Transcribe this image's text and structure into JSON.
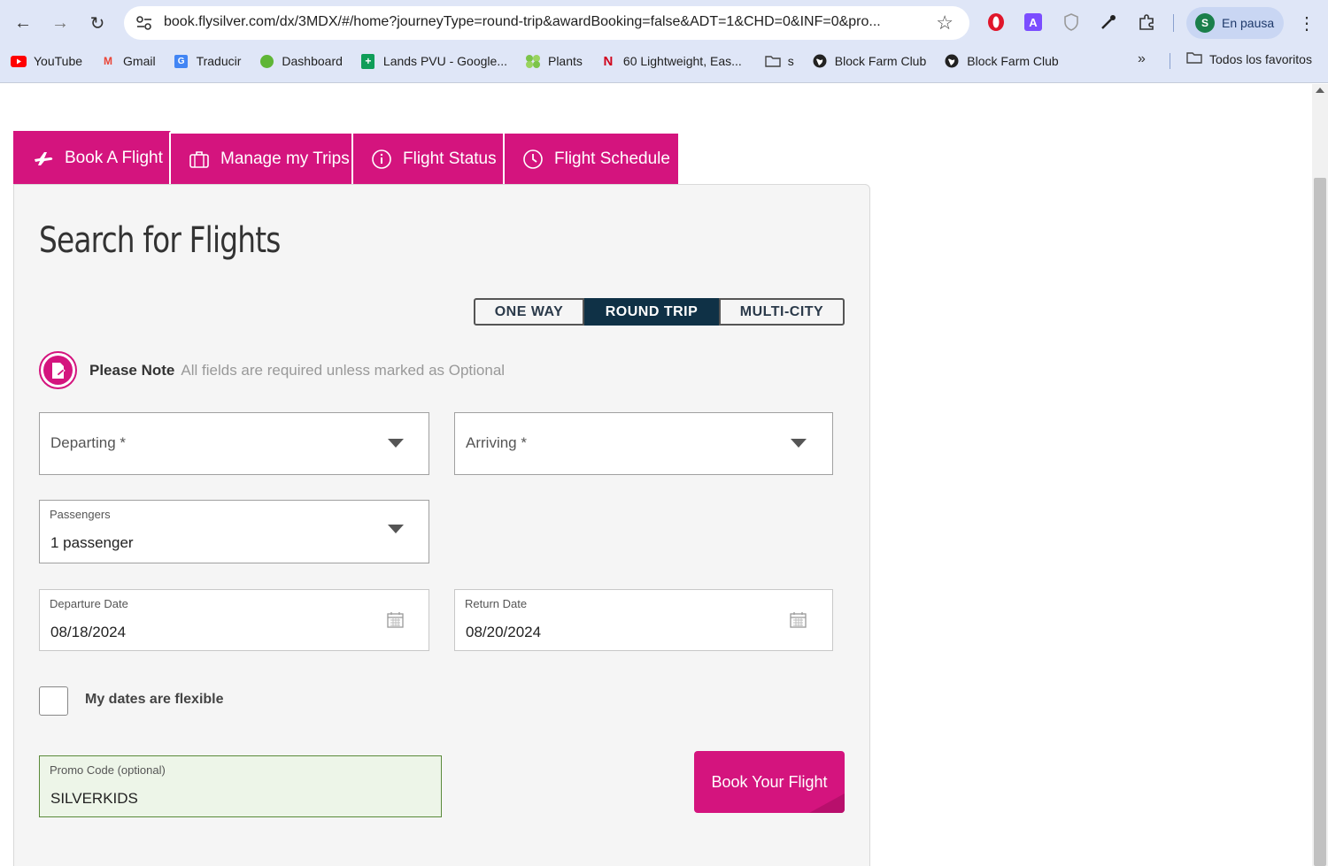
{
  "browser": {
    "url": "book.flysilver.com/dx/3MDX/#/home?journeyType=round-trip&awardBooking=false&ADT=1&CHD=0&INF=0&pro...",
    "profile_initial": "S",
    "profile_status": "En pausa",
    "bookmarks": [
      {
        "label": "YouTube",
        "icon": "youtube-icon",
        "color": "#ff0000"
      },
      {
        "label": "Gmail",
        "icon": "gmail-icon",
        "color": "#ea4335"
      },
      {
        "label": "Traducir",
        "icon": "translate-icon",
        "color": "#4285f4"
      },
      {
        "label": "Dashboard",
        "icon": "dashboard-icon",
        "color": "#5fb636"
      },
      {
        "label": "Lands PVU - Google...",
        "icon": "sheets-icon",
        "color": "#0f9d58"
      },
      {
        "label": "Plants",
        "icon": "plants-icon",
        "color": "#7cc44a"
      },
      {
        "label": "60 Lightweight, Eas...",
        "icon": "n-icon",
        "color": "#d0021b"
      },
      {
        "label": "s",
        "icon": "folder-icon",
        "color": "#444444"
      },
      {
        "label": "Block Farm Club",
        "icon": "globe-icon",
        "color": "#222222"
      },
      {
        "label": "Block Farm Club",
        "icon": "globe-icon",
        "color": "#222222"
      }
    ],
    "more_bookmarks": "»",
    "all_bookmarks": "Todos los favoritos"
  },
  "tabs": {
    "book": "Book A Flight",
    "manage": "Manage my Trips",
    "status": "Flight Status",
    "schedule": "Flight Schedule"
  },
  "search": {
    "title": "Search for Flights",
    "trip_types": {
      "one_way": "ONE WAY",
      "round_trip": "ROUND TRIP",
      "multi_city": "MULTI-CITY"
    },
    "active_trip_type": "ROUND TRIP",
    "note_label": "Please Note",
    "note_text": "All fields are required unless marked as Optional",
    "departing_placeholder": "Departing *",
    "arriving_placeholder": "Arriving *",
    "passengers_label": "Passengers",
    "passengers_value": "1 passenger",
    "departure_date_label": "Departure Date",
    "departure_date_value": "08/18/2024",
    "return_date_label": "Return Date",
    "return_date_value": "08/20/2024",
    "flexible_label": "My dates are flexible",
    "promo_label": "Promo Code (optional)",
    "promo_value": "SILVERKIDS",
    "submit": "Book Your Flight"
  },
  "colors": {
    "brand": "#d4147e",
    "active_toggle": "#0f3146",
    "promo_bg": "#edf5e8"
  }
}
